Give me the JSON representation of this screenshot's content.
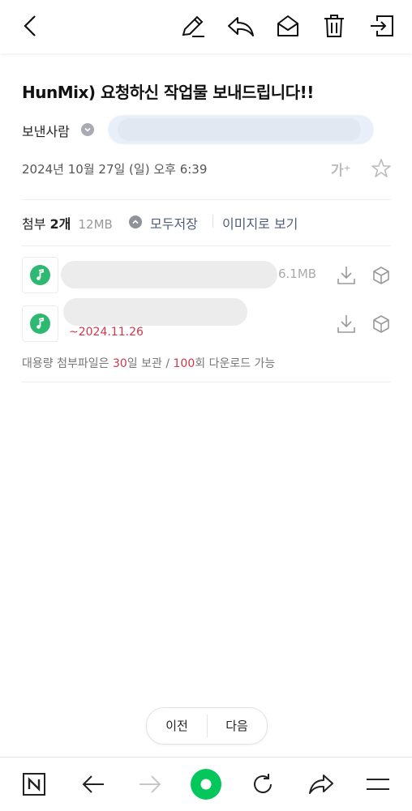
{
  "toolbar": {
    "back_icon": "chevron-left-icon",
    "edit_icon": "pencil-icon",
    "reply_icon": "reply-icon",
    "mark_unread_icon": "envelope-open-icon",
    "delete_icon": "trash-icon",
    "move_icon": "move-folder-icon"
  },
  "mail": {
    "subject": "HunMix) 요청하신 작업물 보내드립니다!!",
    "sender_label": "보낸사람",
    "date": "2024년 10월 27일 (일) 오후 6:39",
    "font_size_label": "가⁺"
  },
  "attachments": {
    "label": "첨부",
    "count": "2개",
    "total_size": "12MB",
    "save_all": "모두저장",
    "view_as_image": "이미지로 보기",
    "files": [
      {
        "size": "6.1MB"
      },
      {
        "expires": "~2024.11.26"
      }
    ],
    "notice_prefix": "대용량 첨부파일은 ",
    "notice_days": "30",
    "notice_mid": "일 보관 / ",
    "notice_count": "100",
    "notice_suffix": "회 다운로드 가능"
  },
  "pager": {
    "prev": "이전",
    "next": "다음"
  },
  "bottom_nav": {
    "items": [
      "naver-home-icon",
      "back-arrow-icon",
      "forward-arrow-icon",
      "green-dot-icon",
      "refresh-icon",
      "share-icon",
      "menu-icon"
    ]
  },
  "colors": {
    "accent_red": "#d0364c",
    "link_blue": "#4f5c7a",
    "music_green": "#2eb872",
    "naver_green": "#03c75a"
  }
}
